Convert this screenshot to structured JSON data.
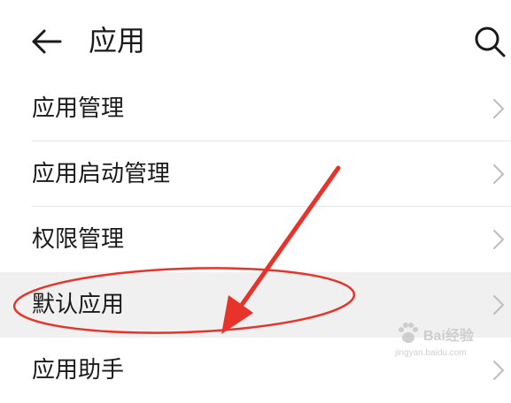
{
  "header": {
    "title": "应用",
    "back_icon": "arrow-left-icon",
    "search_icon": "search-icon"
  },
  "list": {
    "items": [
      {
        "label": "应用管理"
      },
      {
        "label": "应用启动管理"
      },
      {
        "label": "权限管理"
      },
      {
        "label": "默认应用"
      },
      {
        "label": "应用助手"
      }
    ],
    "highlighted_item": "默认应用"
  },
  "annotation": {
    "color": "#e8332a",
    "shapes": [
      "circle",
      "arrow"
    ]
  },
  "watermark": {
    "text": "Bai经验",
    "subtext": "jingyan.baidu.com"
  },
  "colors": {
    "background": "#ffffff",
    "highlight_row": "#f0f0f0",
    "text": "#1a1a1a",
    "chevron": "#bdbdbd",
    "divider": "#e6e6e6",
    "annotation_red": "#e8332a"
  }
}
